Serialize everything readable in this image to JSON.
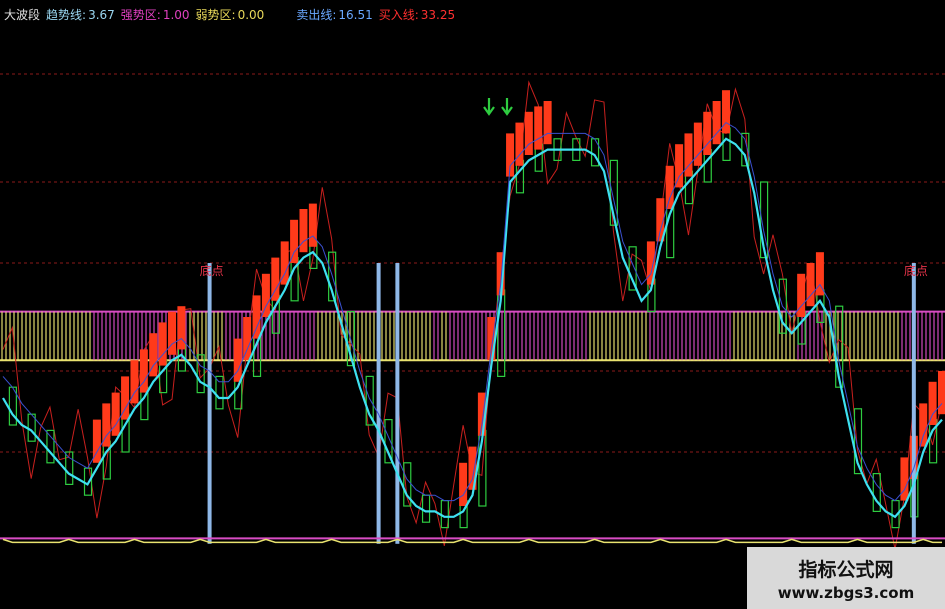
{
  "header": {
    "name": "大波段",
    "trend_label": "趋势线:",
    "trend_value": "3.67",
    "strong_label": "强势区:",
    "strong_value": "1.00",
    "weak_label": "弱势区:",
    "weak_value": "0.00",
    "sell_label": "卖出线:",
    "sell_value": "16.51",
    "buy_label": "买入线:",
    "buy_value": "33.25"
  },
  "colors": {
    "trend": "#9ad6f0",
    "strong": "#e040c0",
    "weak": "#e8d85a",
    "sell": "#6aa8ff",
    "buy": "#ff3030",
    "cyan": "#3ee0f0",
    "magenta": "#d94cc4",
    "yellow": "#e9e370",
    "green": "#2ecc40",
    "blue_bar": "#8fb8e8",
    "grid": "#8b1a1a",
    "thin_red": "#c8201e"
  },
  "annotations": {
    "bottom_point_1": "底点",
    "bottom_point_2": "底点",
    "arrow_1": "down-arrow-icon",
    "arrow_2": "down-arrow-icon"
  },
  "watermark": {
    "line1": "指标公式网",
    "line2": "www.zbgs3.com"
  },
  "chart_data": {
    "type": "line",
    "title": "",
    "xlabel": "",
    "ylabel": "",
    "ylim": [
      0,
      100
    ],
    "grid": "dashed horizontal",
    "x": [
      0,
      1,
      2,
      3,
      4,
      5,
      6,
      7,
      8,
      9,
      10,
      11,
      12,
      13,
      14,
      15,
      16,
      17,
      18,
      19,
      20,
      21,
      22,
      23,
      24,
      25,
      26,
      27,
      28,
      29,
      30,
      31,
      32,
      33,
      34,
      35,
      36,
      37,
      38,
      39,
      40,
      41,
      42,
      43,
      44,
      45,
      46,
      47,
      48,
      49,
      50,
      51,
      52,
      53,
      54,
      55,
      56,
      57,
      58,
      59,
      60,
      61,
      62,
      63,
      64,
      65,
      66,
      67,
      68,
      69,
      70,
      71,
      72,
      73,
      74,
      75,
      76,
      77,
      78,
      79,
      80,
      81,
      82,
      83,
      84,
      85,
      86,
      87,
      88,
      89,
      90,
      91,
      92,
      93,
      94,
      95,
      96,
      97,
      98,
      99,
      100
    ],
    "series": [
      {
        "values": [
          30,
          27,
          25,
          24,
          22,
          20,
          18,
          16,
          15,
          14,
          17,
          20,
          22,
          25,
          28,
          30,
          33,
          35,
          37,
          38,
          36,
          33,
          32,
          30,
          30,
          32,
          36,
          40,
          44,
          47,
          50,
          54,
          56,
          57,
          55,
          50,
          44,
          38,
          32,
          27,
          24,
          20,
          16,
          12,
          10,
          9,
          9,
          8,
          8,
          9,
          12,
          22,
          36,
          48,
          70,
          72,
          74,
          75,
          76,
          76,
          76,
          76,
          76,
          75,
          72,
          64,
          56,
          52,
          48,
          50,
          58,
          64,
          68,
          70,
          72,
          74,
          76,
          78,
          77,
          75,
          68,
          58,
          50,
          44,
          42,
          44,
          46,
          48,
          45,
          34,
          26,
          18,
          14,
          11,
          9,
          8,
          10,
          14,
          20,
          24,
          26
        ]
      },
      {
        "values": [
          34,
          32,
          29,
          27,
          25,
          23,
          21,
          19,
          18,
          17,
          20,
          23,
          25,
          28,
          31,
          33,
          36,
          38,
          40,
          41,
          39,
          36,
          35,
          33,
          33,
          35,
          39,
          43,
          47,
          50,
          53,
          57,
          59,
          60,
          58,
          53,
          47,
          41,
          35,
          30,
          27,
          23,
          19,
          15,
          13,
          12,
          12,
          11,
          11,
          12,
          15,
          25,
          39,
          51,
          73,
          75,
          77,
          78,
          79,
          79,
          79,
          79,
          79,
          78,
          75,
          67,
          59,
          55,
          51,
          53,
          61,
          67,
          71,
          73,
          75,
          77,
          79,
          81,
          80,
          78,
          71,
          61,
          53,
          47,
          45,
          47,
          49,
          51,
          48,
          37,
          29,
          21,
          17,
          14,
          12,
          11,
          13,
          17,
          23,
          27,
          29
        ]
      }
    ],
    "bands": {
      "strong_zone": [
        37,
        46
      ],
      "bottom_line": 4
    },
    "signals": [
      {
        "x": 22,
        "label": "底点"
      },
      {
        "x": 97,
        "label": "底点"
      }
    ]
  }
}
